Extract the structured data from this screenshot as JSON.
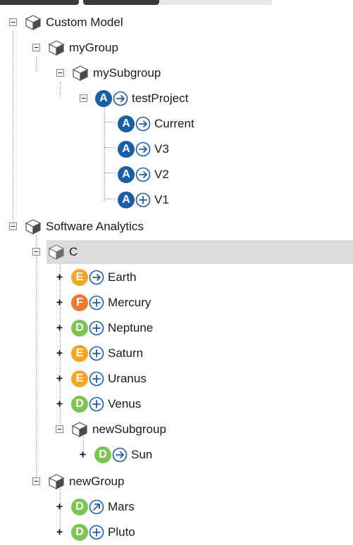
{
  "colors": {
    "grade_A": "#1a5ea8",
    "grade_D": "#7cc553",
    "grade_E": "#f5a623",
    "grade_F": "#f0772f",
    "action_arrow": "#1a5ea8",
    "selection": "#dcdcdc"
  },
  "tree": {
    "nodes": [
      {
        "label": "Custom Model",
        "type": "group",
        "toggle": "−"
      },
      {
        "label": "myGroup",
        "type": "group",
        "toggle": "−"
      },
      {
        "label": "mySubgroup",
        "type": "group",
        "toggle": "−"
      },
      {
        "label": "testProject",
        "type": "project",
        "toggle": "−",
        "grade": "A",
        "action": "arrow-right"
      },
      {
        "label": "Current",
        "type": "version",
        "grade": "A",
        "action": "arrow-right"
      },
      {
        "label": "V3",
        "type": "version",
        "grade": "A",
        "action": "arrow-right"
      },
      {
        "label": "V2",
        "type": "version",
        "grade": "A",
        "action": "arrow-right"
      },
      {
        "label": "V1",
        "type": "version",
        "grade": "A",
        "action": "plus"
      },
      {
        "label": "Software Analytics",
        "type": "group",
        "toggle": "−"
      },
      {
        "label": "C",
        "type": "group",
        "toggle": "−",
        "selected": true,
        "muted": true
      },
      {
        "label": "Earth",
        "type": "project",
        "toggle": "+",
        "grade": "E",
        "action": "arrow-right"
      },
      {
        "label": "Mercury",
        "type": "project",
        "toggle": "+",
        "grade": "F",
        "action": "plus"
      },
      {
        "label": "Neptune",
        "type": "project",
        "toggle": "+",
        "grade": "D",
        "action": "plus"
      },
      {
        "label": "Saturn",
        "type": "project",
        "toggle": "+",
        "grade": "E",
        "action": "plus"
      },
      {
        "label": "Uranus",
        "type": "project",
        "toggle": "+",
        "grade": "E",
        "action": "plus"
      },
      {
        "label": "Venus",
        "type": "project",
        "toggle": "+",
        "grade": "D",
        "action": "plus"
      },
      {
        "label": "newSubgroup",
        "type": "group",
        "toggle": "−"
      },
      {
        "label": "Sun",
        "type": "project",
        "toggle": "+",
        "grade": "D",
        "action": "arrow-right"
      },
      {
        "label": "newGroup",
        "type": "group",
        "toggle": "−"
      },
      {
        "label": "Mars",
        "type": "project",
        "toggle": "+",
        "grade": "D",
        "action": "arrow-up-right"
      },
      {
        "label": "Pluto",
        "type": "project",
        "toggle": "+",
        "grade": "D",
        "action": "plus"
      }
    ]
  }
}
